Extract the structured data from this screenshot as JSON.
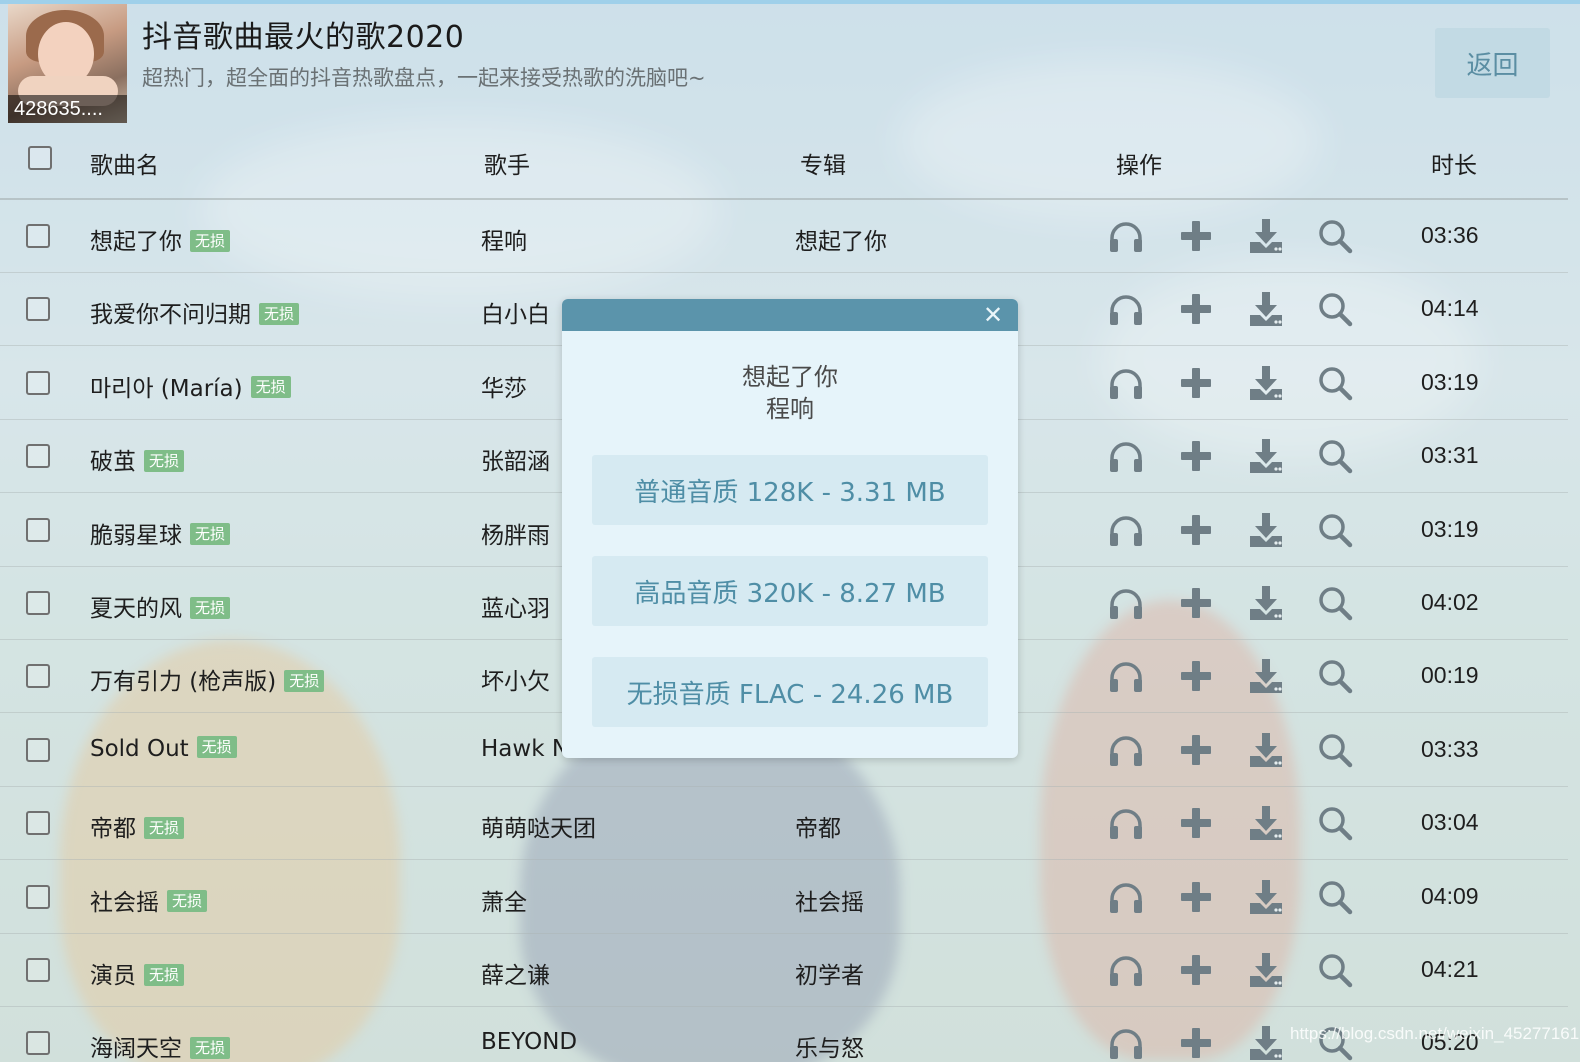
{
  "header": {
    "title": "抖音歌曲最火的歌2020",
    "subtitle": "超热门，超全面的抖音热歌盘点，一起来接受热歌的洗脑吧~",
    "play_count": "428635....",
    "back_label": "返回"
  },
  "columns": {
    "song": "歌曲名",
    "artist": "歌手",
    "album": "专辑",
    "actions": "操作",
    "duration": "时长"
  },
  "lossless_badge": "无损",
  "songs": [
    {
      "title": "想起了你",
      "artist": "程响",
      "album": "想起了你",
      "duration": "03:36"
    },
    {
      "title": "我爱你不问归期",
      "artist": "白小白",
      "album": "",
      "duration": "04:14"
    },
    {
      "title": "마리아 (María)",
      "artist": "华莎",
      "album": "",
      "duration": "03:19"
    },
    {
      "title": "破茧",
      "artist": "张韶涵",
      "album": "",
      "duration": "03:31"
    },
    {
      "title": "脆弱星球",
      "artist": "杨胖雨",
      "album": "",
      "duration": "03:19"
    },
    {
      "title": "夏天的风",
      "artist": "蓝心羽",
      "album": "",
      "duration": "04:02"
    },
    {
      "title": "万有引力 (枪声版)",
      "artist": "坏小欠",
      "album": "",
      "duration": "00:19"
    },
    {
      "title": "Sold Out",
      "artist": "Hawk N",
      "album": "",
      "duration": "03:33"
    },
    {
      "title": "帝都",
      "artist": "萌萌哒天团",
      "album": "帝都",
      "duration": "03:04"
    },
    {
      "title": "社会摇",
      "artist": "萧全",
      "album": "社会摇",
      "duration": "04:09"
    },
    {
      "title": "演员",
      "artist": "薛之谦",
      "album": "初学者",
      "duration": "04:21"
    },
    {
      "title": "海阔天空",
      "artist": "BEYOND",
      "album": "乐与怒",
      "duration": "05:20"
    }
  ],
  "modal": {
    "close_symbol": "✕",
    "song_title": "想起了你",
    "song_artist": "程响",
    "options": [
      "普通音质 128K - 3.31 MB",
      "高品音质 320K - 8.27 MB",
      "无损音质 FLAC - 24.26 MB"
    ]
  },
  "icons": [
    "headphones-icon",
    "plus-icon",
    "download-icon",
    "search-icon"
  ],
  "colors": {
    "accent": "#5b94ab",
    "lossless_badge": "#7fbd88",
    "icon": "#6f7e86"
  },
  "watermark": "https://blog.csdn.net/weixin_45277161"
}
